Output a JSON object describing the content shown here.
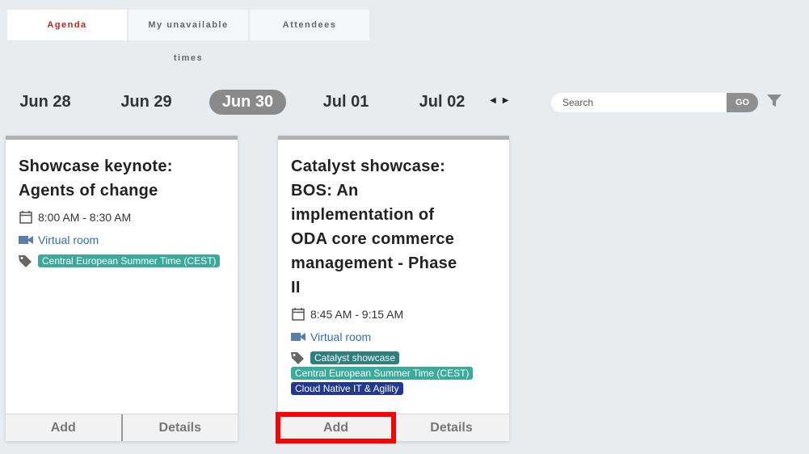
{
  "tabs": [
    {
      "label": "Agenda"
    },
    {
      "label_line1": "My unavailable",
      "label_line2": "times"
    },
    {
      "label": "Attendees"
    }
  ],
  "dates": [
    "Jun 28",
    "Jun 29",
    "Jun 30",
    "Jul 01",
    "Jul 02"
  ],
  "active_date": "Jun 30",
  "search": {
    "placeholder": "Search",
    "go_label": "GO"
  },
  "sessions": [
    {
      "title_lines": [
        "Showcase keynote:",
        "Agents of change"
      ],
      "time": "8:00 AM - 8:30 AM",
      "location": "Virtual room",
      "tags": [
        "Central European Summer Time (CEST)"
      ],
      "add_label": "Add",
      "details_label": "Details"
    },
    {
      "title_lines": [
        "Catalyst showcase:",
        "BOS: An",
        "implementation of",
        "ODA core commerce",
        "management - Phase",
        "II"
      ],
      "time": "8:45 AM - 9:15 AM",
      "location": "Virtual room",
      "tags": [
        "Catalyst showcase",
        "Central European Summer Time (CEST)",
        "Cloud Native IT & Agility"
      ],
      "add_label": "Add",
      "details_label": "Details"
    }
  ],
  "colors": {
    "active_tab_text": "#c81e1e",
    "active_date_bg": "#8a8a8a",
    "link": "#2f6fb0",
    "tag_teal": "#3aaa9a",
    "tag_darkteal": "#2e7f7f",
    "tag_navy": "#22388f",
    "highlight": "#ff0000"
  },
  "icons": {
    "time": "calendar-icon",
    "location": "video-camera-icon",
    "tags": "tag-icon",
    "filter": "filter-icon",
    "prev": "chevron-left-icon",
    "next": "chevron-right-icon"
  }
}
